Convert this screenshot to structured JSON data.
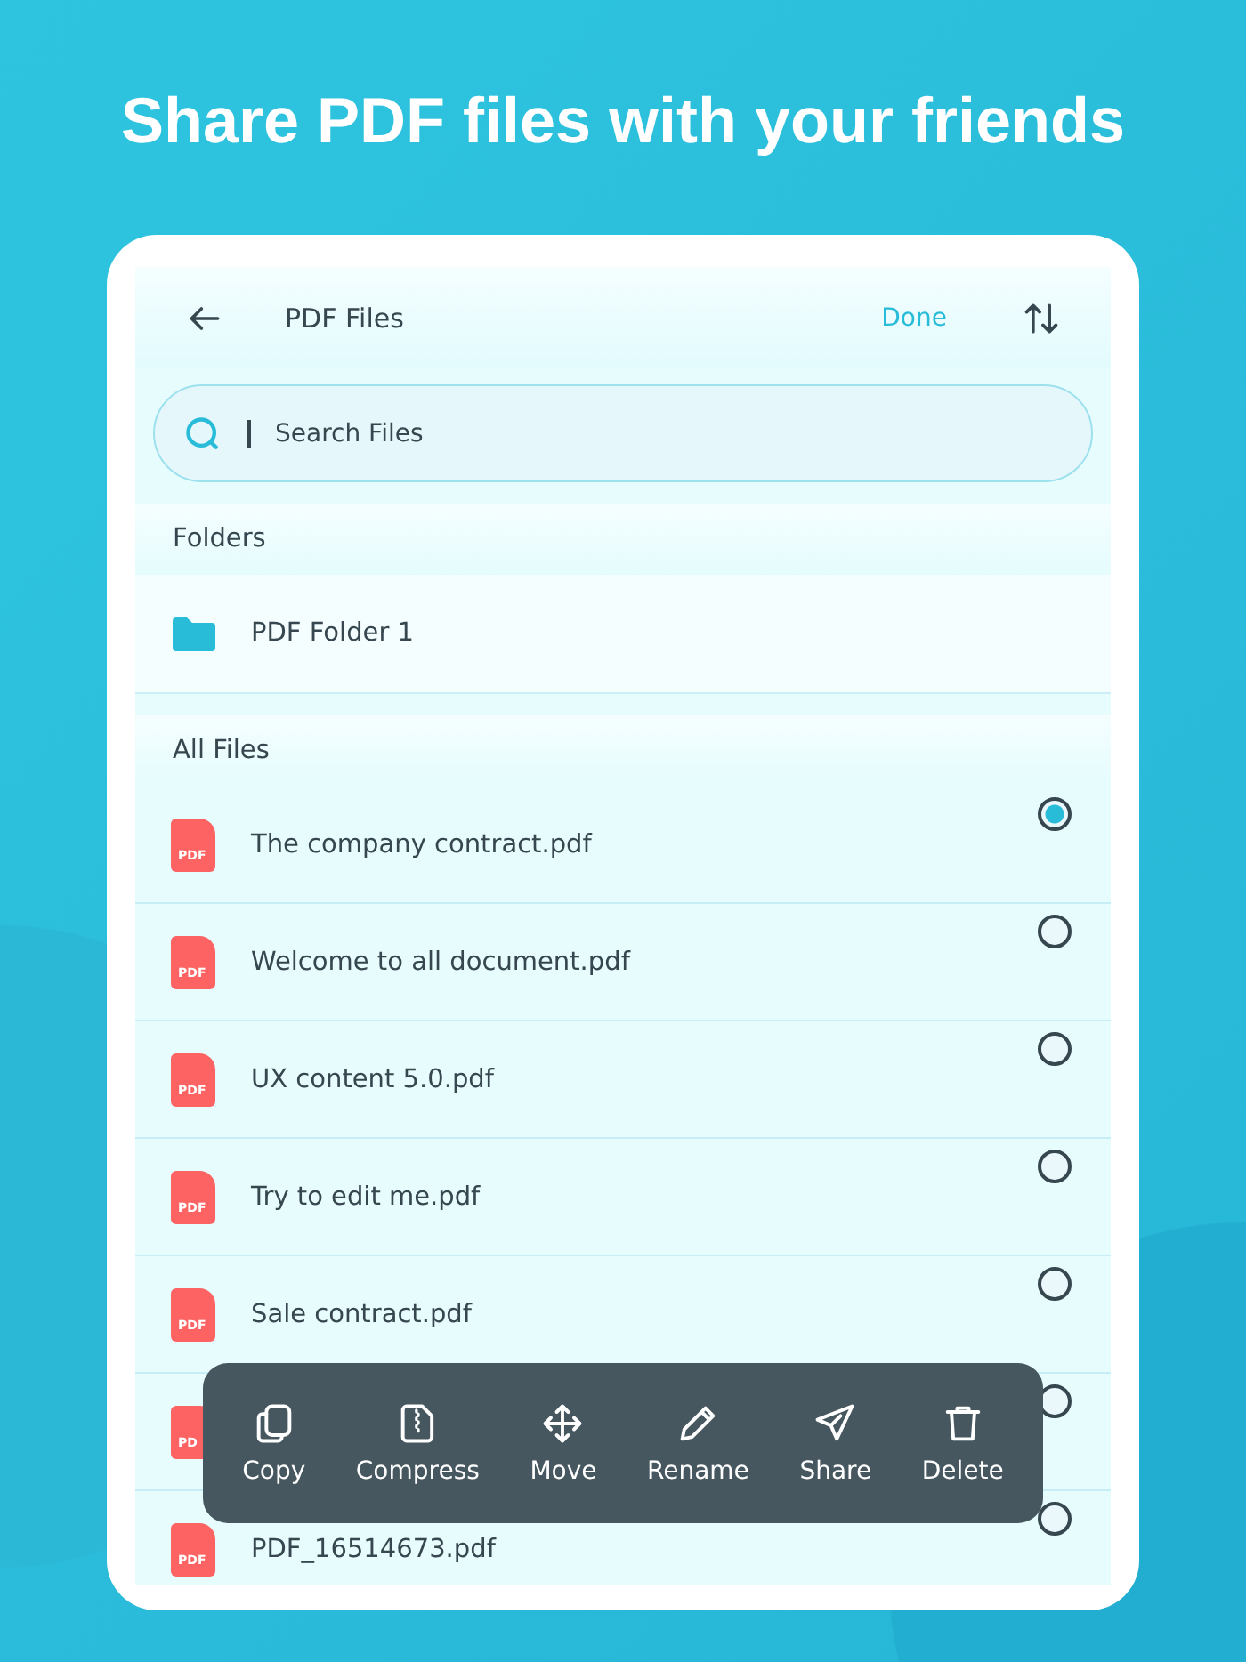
{
  "headline": "Share PDF files with your friends",
  "header": {
    "title": "PDF Files",
    "action": "Done"
  },
  "search": {
    "placeholder": "Search Files"
  },
  "folders": {
    "heading": "Folders",
    "items": [
      {
        "name": "PDF Folder 1"
      }
    ]
  },
  "files": {
    "heading": "All Files",
    "items": [
      {
        "badge": "PDF",
        "name": "The company contract.pdf",
        "selected": true
      },
      {
        "badge": "PDF",
        "name": "Welcome to all document.pdf",
        "selected": false
      },
      {
        "badge": "PDF",
        "name": "UX content 5.0.pdf",
        "selected": false
      },
      {
        "badge": "PDF",
        "name": "Try to edit me.pdf",
        "selected": false
      },
      {
        "badge": "PDF",
        "name": "Sale contract.pdf",
        "selected": false
      },
      {
        "badge": "PD",
        "selected": false
      },
      {
        "badge": "PDF",
        "name": "PDF_16514673.pdf",
        "selected": false
      }
    ]
  },
  "actions": [
    {
      "kind": "copy",
      "label": "Copy"
    },
    {
      "kind": "compress",
      "label": "Compress"
    },
    {
      "kind": "move",
      "label": "Move"
    },
    {
      "kind": "rename",
      "label": "Rename"
    },
    {
      "kind": "share",
      "label": "Share"
    },
    {
      "kind": "delete",
      "label": "Delete"
    }
  ]
}
